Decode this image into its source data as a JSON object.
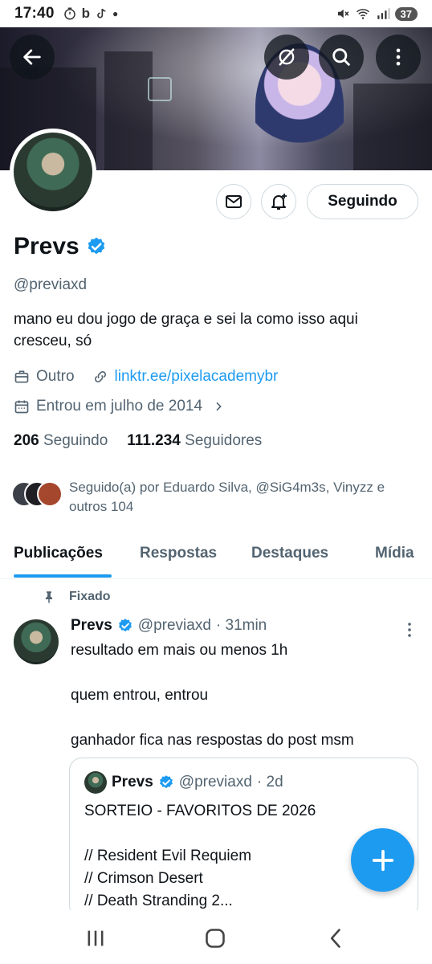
{
  "status_bar": {
    "time": "17:40",
    "battery": "37"
  },
  "profile": {
    "name": "Prevs",
    "handle": "@previaxd",
    "bio": "mano eu dou jogo de graça e sei la como isso aqui cresceu, só",
    "category": "Outro",
    "link": "linktr.ee/pixelacademybr",
    "joined": "Entrou em julho de 2014",
    "following_count": "206",
    "following_label": "Seguindo",
    "followers_count": "111.234",
    "followers_label": "Seguidores",
    "followed_by": "Seguido(a) por Eduardo Silva, @SiG4m3s, Vinyzz e outros 104",
    "follow_button_label": "Seguindo"
  },
  "tabs": [
    {
      "label": "Publicações",
      "active": true
    },
    {
      "label": "Respostas",
      "active": false
    },
    {
      "label": "Destaques",
      "active": false
    },
    {
      "label": "Mídia",
      "active": false
    }
  ],
  "pinned_tweet": {
    "pinned_label": "Fixado",
    "author_name": "Prevs",
    "author_handle": "@previaxd",
    "time": "· 31min",
    "lines": [
      "resultado em mais ou menos 1h",
      "",
      "quem entrou, entrou",
      "",
      "ganhador fica nas respostas do post msm"
    ],
    "quote": {
      "author_name": "Prevs",
      "author_handle": "@previaxd",
      "time": "· 2d",
      "lines": [
        "SORTEIO - FAVORITOS DE 2026",
        "",
        "// Resident Evil Requiem",
        "// Crimson Desert",
        "// Death Stranding 2..."
      ]
    }
  },
  "colors": {
    "accent": "#1d9bf0",
    "text_primary": "#0f1419",
    "text_secondary": "#536471",
    "border": "#cfd9de"
  },
  "icons": {
    "back": "back-arrow-icon",
    "grok": "grok-icon",
    "search": "search-icon",
    "more": "more-vertical-icon",
    "message": "mail-icon",
    "notify": "bell-plus-icon",
    "verified": "verified-badge-icon",
    "pin": "pin-icon",
    "compose": "plus-icon"
  }
}
